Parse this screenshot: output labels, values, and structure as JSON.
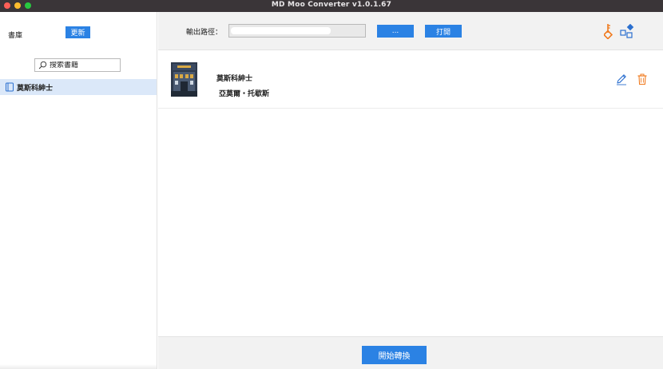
{
  "window": {
    "title": "MD Moo Converter v1.0.1.67"
  },
  "sidebar": {
    "library_label": "書庫",
    "refresh_label": "更新",
    "search_placeholder": "搜索書籍",
    "books": [
      {
        "title": "莫斯科紳士",
        "selected": true
      }
    ]
  },
  "toolbar": {
    "output_path_label": "輸出路徑：",
    "output_path_value": "",
    "browse_label": "...",
    "open_label": "打開",
    "key_icon": "key-icon",
    "apps_icon": "apps-icon"
  },
  "book_list": [
    {
      "title": "莫斯科紳士",
      "author": "亞莫爾・托歇斯",
      "edit_icon": "pencil-icon",
      "delete_icon": "trash-icon"
    }
  ],
  "footer": {
    "convert_label": "開始轉換"
  },
  "colors": {
    "accent": "#2b82e4",
    "selection": "#dbe8f9",
    "key_orange": "#f07a1e",
    "delete_orange": "#f07a1e"
  }
}
